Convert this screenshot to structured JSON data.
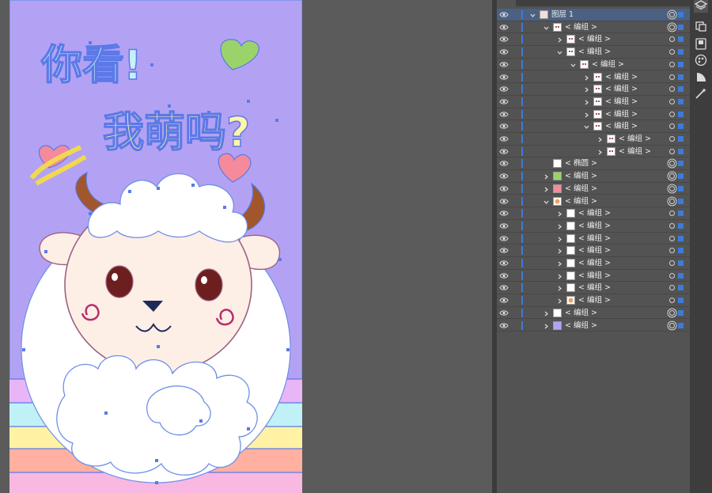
{
  "artboard": {
    "text_line1": "你看!",
    "text_line2": "我萌吗?",
    "bg_color": "#b3a2f3",
    "stripe_colors": [
      "#e8b6f6",
      "#bff1f6",
      "#fff2a4",
      "#ffb0a0",
      "#f8b8e2"
    ]
  },
  "layers": {
    "rows": [
      {
        "label": "图层 1",
        "depth": 0,
        "chev": "down",
        "selected": true,
        "thumb": "sheep"
      },
      {
        "label": "< 编组 >",
        "depth": 1,
        "chev": "down",
        "thumb": "face"
      },
      {
        "label": "< 编组 >",
        "depth": 2,
        "chev": "right",
        "thumb": "face"
      },
      {
        "label": "< 编组 >",
        "depth": 2,
        "chev": "down",
        "thumb": "face"
      },
      {
        "label": "< 编组 >",
        "depth": 3,
        "chev": "down",
        "thumb": "face"
      },
      {
        "label": "< 编组 >",
        "depth": 4,
        "chev": "right",
        "thumb": "dots"
      },
      {
        "label": "< 编组 >",
        "depth": 4,
        "chev": "right",
        "thumb": "red"
      },
      {
        "label": "< 编组 >",
        "depth": 4,
        "chev": "right",
        "thumb": "heart"
      },
      {
        "label": "< 编组 >",
        "depth": 4,
        "chev": "right",
        "thumb": "red"
      },
      {
        "label": "< 编组 >",
        "depth": 4,
        "chev": "down",
        "thumb": "red"
      },
      {
        "label": "< 编组 >",
        "depth": 5,
        "chev": "right",
        "thumb": "red"
      },
      {
        "label": "< 编组 >",
        "depth": 5,
        "chev": "right",
        "thumb": "red"
      },
      {
        "label": "< 椭圆 >",
        "depth": 1,
        "chev": "none",
        "thumb": "white"
      },
      {
        "label": "< 编组 >",
        "depth": 1,
        "chev": "right",
        "thumb": "green"
      },
      {
        "label": "< 编组 >",
        "depth": 1,
        "chev": "right",
        "thumb": "pink"
      },
      {
        "label": "< 编组 >",
        "depth": 1,
        "chev": "down",
        "thumb": "orange"
      },
      {
        "label": "< 编组 >",
        "depth": 2,
        "chev": "right",
        "thumb": "white"
      },
      {
        "label": "< 编组 >",
        "depth": 2,
        "chev": "right",
        "thumb": "white"
      },
      {
        "label": "< 编组 >",
        "depth": 2,
        "chev": "right",
        "thumb": "white"
      },
      {
        "label": "< 编组 >",
        "depth": 2,
        "chev": "right",
        "thumb": "white"
      },
      {
        "label": "< 编组 >",
        "depth": 2,
        "chev": "right",
        "thumb": "white"
      },
      {
        "label": "< 编组 >",
        "depth": 2,
        "chev": "right",
        "thumb": "white"
      },
      {
        "label": "< 编组 >",
        "depth": 2,
        "chev": "right",
        "thumb": "white"
      },
      {
        "label": "< 编组 >",
        "depth": 2,
        "chev": "right",
        "thumb": "orange"
      },
      {
        "label": "< 编组 >",
        "depth": 1,
        "chev": "right",
        "thumb": "white"
      },
      {
        "label": "< 编组 >",
        "depth": 1,
        "chev": "right",
        "thumb": "purple"
      }
    ]
  },
  "tools": [
    "layers-icon",
    "libraries-icon",
    "export-icon",
    "color-palette-icon",
    "gradient-icon",
    "magic-wand-icon"
  ],
  "colors": {
    "selection": "#3d7bd9",
    "panel": "#535353",
    "canvas": "#5b5b5b"
  }
}
